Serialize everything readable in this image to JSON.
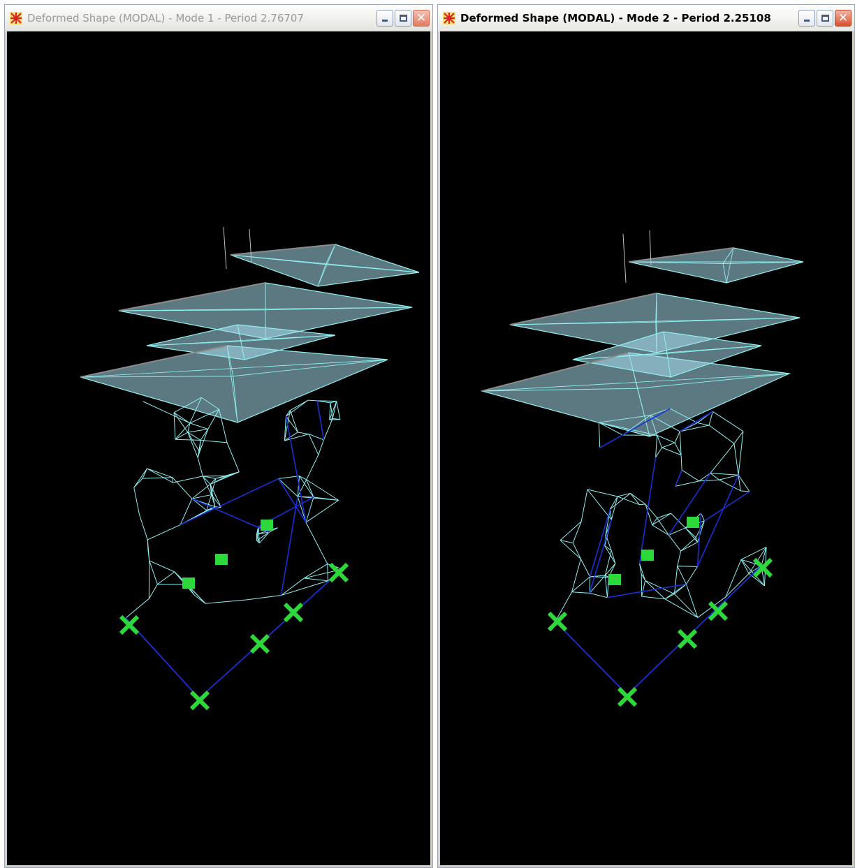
{
  "windows": [
    {
      "title": "Deformed Shape (MODAL) - Mode 1 - Period 2.76707",
      "state": "inactive",
      "controls": [
        "minimize-icon",
        "maximize-icon",
        "close-icon"
      ]
    },
    {
      "title": "Deformed Shape (MODAL) - Mode 2 - Period 2.25108",
      "state": "active",
      "controls": [
        "minimize-icon",
        "maximize-icon",
        "close-icon"
      ]
    }
  ],
  "colors": {
    "viewport_background": "#000000",
    "frame_line": "#8ff0f0",
    "frame_line_dark": "#1a2fd6",
    "slab_fill": "#a8dcec",
    "support": "#2cd83a",
    "grey_edge": "#8a8a8a"
  },
  "glyphs": {
    "close": "✕"
  }
}
